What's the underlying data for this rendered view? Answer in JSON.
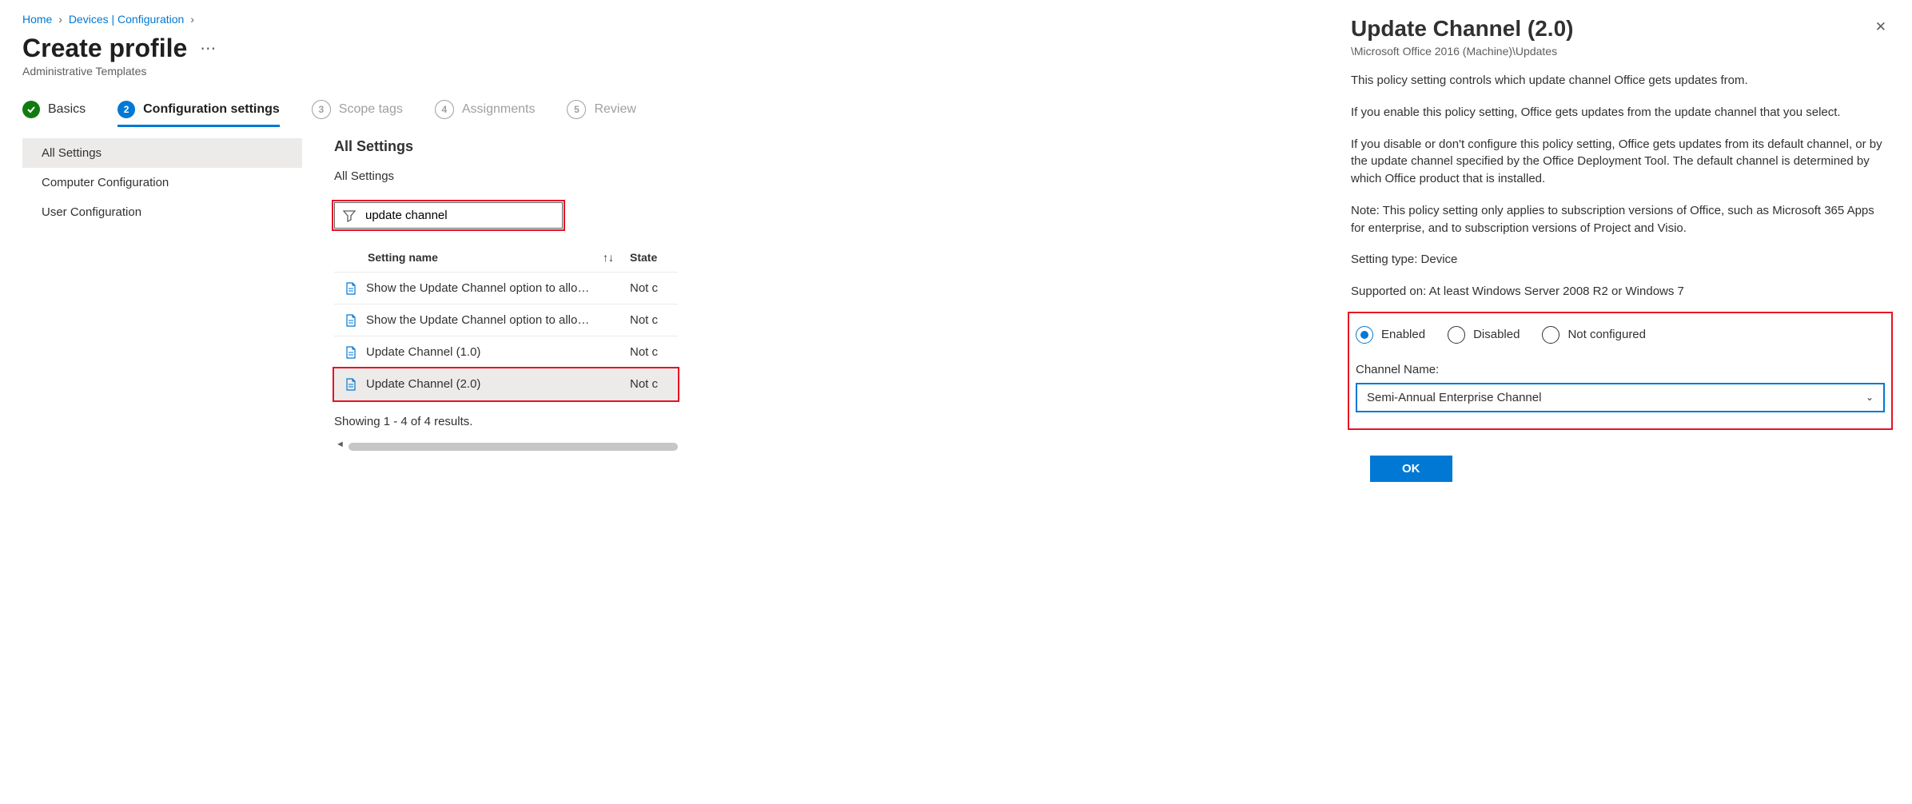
{
  "breadcrumb": {
    "home": "Home",
    "devices": "Devices | Configuration"
  },
  "page": {
    "title": "Create profile",
    "subtitle": "Administrative Templates"
  },
  "steps": {
    "s1": "Basics",
    "s2": "Configuration settings",
    "s3": "Scope tags",
    "s4": "Assignments",
    "s5": "Review"
  },
  "sidebar": {
    "all": "All Settings",
    "computer": "Computer Configuration",
    "user": "User Configuration"
  },
  "settings": {
    "heading": "All Settings",
    "sub": "All Settings",
    "filter_value": "update channel",
    "col_name": "Setting name",
    "col_state": "State",
    "sort_glyph": "↑↓",
    "rows": [
      {
        "name": "Show the Update Channel option to allo…",
        "state": "Not c"
      },
      {
        "name": "Show the Update Channel option to allo…",
        "state": "Not c"
      },
      {
        "name": "Update Channel (1.0)",
        "state": "Not c"
      },
      {
        "name": "Update Channel (2.0)",
        "state": "Not c"
      }
    ],
    "results": "Showing 1 - 4 of 4 results."
  },
  "panel": {
    "title": "Update Channel (2.0)",
    "path": "\\Microsoft Office 2016 (Machine)\\Updates",
    "p1": "This policy setting controls which update channel Office gets updates from.",
    "p2": "If you enable this policy setting, Office gets updates from the update channel that you select.",
    "p3": "If you disable or don't configure this policy setting, Office gets updates from its default channel, or by the update channel specified by the Office Deployment Tool. The default channel is determined by which Office product that is installed.",
    "p4": "Note: This policy setting only applies to subscription versions of Office, such as Microsoft 365 Apps for enterprise, and to subscription versions of Project and Visio.",
    "setting_type": "Setting type: Device",
    "supported": "Supported on: At least Windows Server 2008 R2 or Windows 7",
    "radio": {
      "enabled": "Enabled",
      "disabled": "Disabled",
      "notconf": "Not configured"
    },
    "channel_label": "Channel Name:",
    "channel_value": "Semi-Annual Enterprise Channel",
    "ok": "OK"
  }
}
